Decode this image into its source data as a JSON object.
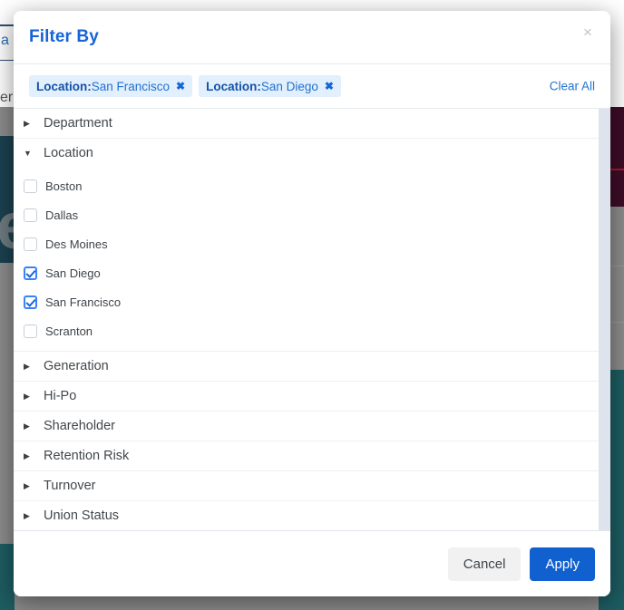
{
  "background": {
    "fragment_a": "a",
    "fragment_er": "er",
    "fragment_e": "e"
  },
  "modal": {
    "title": "Filter By",
    "close_label": "×",
    "close_icon": "close-icon",
    "chips": [
      {
        "key": "Location:",
        "value": "San Francisco",
        "remove_icon": "✖"
      },
      {
        "key": "Location:",
        "value": "San Diego",
        "remove_icon": "✖"
      }
    ],
    "clear_all_label": "Clear All",
    "groups": [
      {
        "label": "Department",
        "expanded": false,
        "caret": "▶",
        "options": []
      },
      {
        "label": "Location",
        "expanded": true,
        "caret": "▼",
        "options": [
          {
            "label": "Boston",
            "checked": false
          },
          {
            "label": "Dallas",
            "checked": false
          },
          {
            "label": "Des Moines",
            "checked": false
          },
          {
            "label": "San Diego",
            "checked": true
          },
          {
            "label": "San Francisco",
            "checked": true
          },
          {
            "label": "Scranton",
            "checked": false
          }
        ]
      },
      {
        "label": "Generation",
        "expanded": false,
        "caret": "▶",
        "options": []
      },
      {
        "label": "Hi-Po",
        "expanded": false,
        "caret": "▶",
        "options": []
      },
      {
        "label": "Shareholder",
        "expanded": false,
        "caret": "▶",
        "options": []
      },
      {
        "label": "Retention Risk",
        "expanded": false,
        "caret": "▶",
        "options": []
      },
      {
        "label": "Turnover",
        "expanded": false,
        "caret": "▶",
        "options": []
      },
      {
        "label": "Union Status",
        "expanded": false,
        "caret": "▶",
        "options": []
      }
    ],
    "footer": {
      "cancel_label": "Cancel",
      "apply_label": "Apply"
    }
  },
  "colors": {
    "accent_blue": "#1565d8",
    "chip_bg": "#e2effc",
    "apply_bg": "#1160cf",
    "cancel_bg": "#f1f1f1",
    "scrollbar": "#dee4ed"
  }
}
